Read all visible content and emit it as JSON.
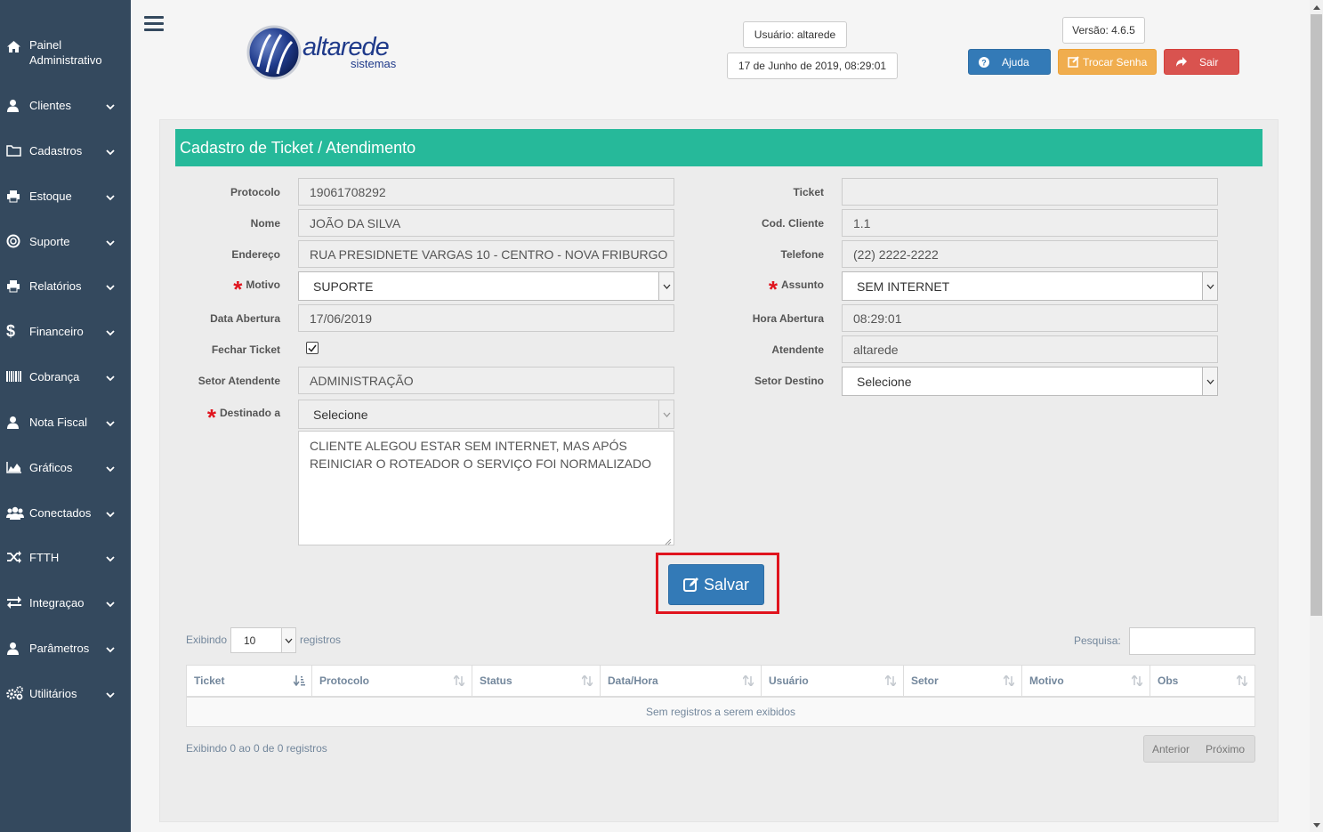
{
  "sidebar": {
    "items": [
      {
        "label": "Painel Administrativo",
        "icon": "home-icon"
      },
      {
        "label": "Clientes",
        "icon": "user-icon"
      },
      {
        "label": "Cadastros",
        "icon": "folder-icon"
      },
      {
        "label": "Estoque",
        "icon": "print-icon"
      },
      {
        "label": "Suporte",
        "icon": "lifebuoy-icon"
      },
      {
        "label": "Relatórios",
        "icon": "print-icon"
      },
      {
        "label": "Financeiro",
        "icon": "dollar-icon"
      },
      {
        "label": "Cobrança",
        "icon": "barcode-icon"
      },
      {
        "label": "Nota Fiscal",
        "icon": "user-icon"
      },
      {
        "label": "Gráficos",
        "icon": "area-chart-icon"
      },
      {
        "label": "Conectados",
        "icon": "users-icon"
      },
      {
        "label": "FTTH",
        "icon": "random-icon"
      },
      {
        "label": "Integraçao",
        "icon": "exchange-icon"
      },
      {
        "label": "Parâmetros",
        "icon": "user-icon"
      },
      {
        "label": "Utilitários",
        "icon": "cogs-icon"
      }
    ]
  },
  "header": {
    "logo_main": "altarede",
    "logo_sub": "sistemas",
    "user": "Usuário: altarede",
    "datetime": "17 de Junho de 2019, 08:29:01",
    "version": "Versão: 4.6.5",
    "help_label": "Ajuda",
    "change_password_label": "Trocar Senha",
    "logout_label": "Sair"
  },
  "form": {
    "title": "Cadastro de Ticket / Atendimento",
    "protocolo_label": "Protocolo",
    "protocolo": "19061708292",
    "nome_label": "Nome",
    "nome": "JOÃO DA SILVA",
    "endereco_label": "Endereço",
    "endereco": "RUA PRESIDNETE VARGAS 10 - CENTRO - NOVA FRIBURGO",
    "motivo_label": "Motivo",
    "motivo": "SUPORTE",
    "data_abertura_label": "Data Abertura",
    "data_abertura": "17/06/2019",
    "fechar_ticket_label": "Fechar Ticket",
    "fechar_ticket_checked": true,
    "setor_atendente_label": "Setor Atendente",
    "setor_atendente": "ADMINISTRAÇÃO",
    "destinado_label": "Destinado a",
    "destinado": "Selecione",
    "observacao": "CLIENTE ALEGOU ESTAR SEM INTERNET, MAS APÓS REINICIAR O ROTEADOR O SERVIÇO FOI NORMALIZADO",
    "ticket_label": "Ticket",
    "ticket": "",
    "cod_cliente_label": "Cod. Cliente",
    "cod_cliente": "1.1",
    "telefone_label": "Telefone",
    "telefone": "(22) 2222-2222",
    "assunto_label": "Assunto",
    "assunto": "SEM INTERNET",
    "hora_abertura_label": "Hora Abertura",
    "hora_abertura": "08:29:01",
    "atendente_label": "Atendente",
    "atendente": "altarede",
    "setor_destino_label": "Setor Destino",
    "setor_destino": "Selecione",
    "save_label": "Salvar"
  },
  "table": {
    "show_label": "Exibindo",
    "page_length": "10",
    "records_label": "registros",
    "search_label": "Pesquisa:",
    "columns": [
      "Ticket",
      "Protocolo",
      "Status",
      "Data/Hora",
      "Usuário",
      "Setor",
      "Motivo",
      "Obs"
    ],
    "empty": "Sem registros a serem exibidos",
    "info": "Exibindo 0 ao 0 de 0 registros",
    "prev": "Anterior",
    "next": "Próximo"
  },
  "colors": {
    "sidebar": "#34495e",
    "panel_header": "#26b99a",
    "primary": "#337ab7",
    "warning": "#f0ad4e",
    "danger": "#d9534f",
    "highlight": "#e0141e"
  }
}
